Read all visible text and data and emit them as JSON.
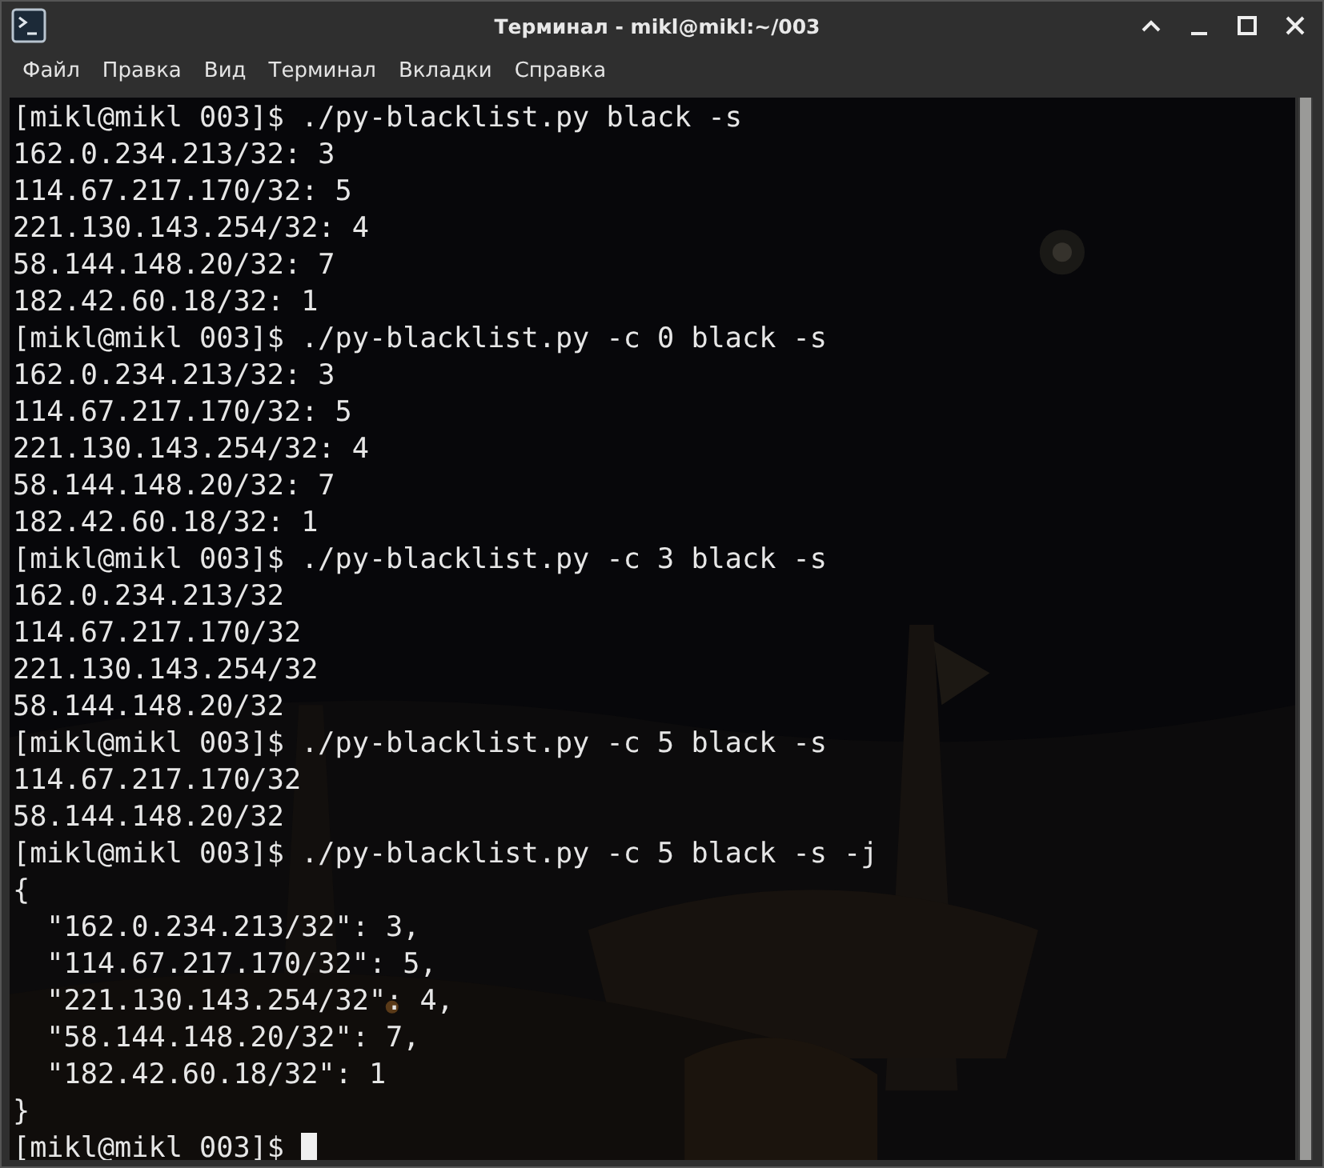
{
  "window": {
    "title": "Терминал - mikl@mikl:~/003"
  },
  "menu": [
    "Файл",
    "Правка",
    "Вид",
    "Терминал",
    "Вкладки",
    "Справка"
  ],
  "terminal": {
    "lines": [
      {
        "text": "[mikl@mikl 003]$ ./py-blacklist.py black -s",
        "cursor": false
      },
      {
        "text": "162.0.234.213/32: 3",
        "cursor": false
      },
      {
        "text": "114.67.217.170/32: 5",
        "cursor": false
      },
      {
        "text": "221.130.143.254/32: 4",
        "cursor": false
      },
      {
        "text": "58.144.148.20/32: 7",
        "cursor": false
      },
      {
        "text": "182.42.60.18/32: 1",
        "cursor": false
      },
      {
        "text": "[mikl@mikl 003]$ ./py-blacklist.py -c 0 black -s",
        "cursor": false
      },
      {
        "text": "162.0.234.213/32: 3",
        "cursor": false
      },
      {
        "text": "114.67.217.170/32: 5",
        "cursor": false
      },
      {
        "text": "221.130.143.254/32: 4",
        "cursor": false
      },
      {
        "text": "58.144.148.20/32: 7",
        "cursor": false
      },
      {
        "text": "182.42.60.18/32: 1",
        "cursor": false
      },
      {
        "text": "[mikl@mikl 003]$ ./py-blacklist.py -c 3 black -s",
        "cursor": false
      },
      {
        "text": "162.0.234.213/32",
        "cursor": false
      },
      {
        "text": "114.67.217.170/32",
        "cursor": false
      },
      {
        "text": "221.130.143.254/32",
        "cursor": false
      },
      {
        "text": "58.144.148.20/32",
        "cursor": false
      },
      {
        "text": "[mikl@mikl 003]$ ./py-blacklist.py -c 5 black -s",
        "cursor": false
      },
      {
        "text": "114.67.217.170/32",
        "cursor": false
      },
      {
        "text": "58.144.148.20/32",
        "cursor": false
      },
      {
        "text": "[mikl@mikl 003]$ ./py-blacklist.py -c 5 black -s -j",
        "cursor": false
      },
      {
        "text": "{",
        "cursor": false
      },
      {
        "text": "  \"162.0.234.213/32\": 3,",
        "cursor": false
      },
      {
        "text": "  \"114.67.217.170/32\": 5,",
        "cursor": false
      },
      {
        "text": "  \"221.130.143.254/32\": 4,",
        "cursor": false
      },
      {
        "text": "  \"58.144.148.20/32\": 7,",
        "cursor": false
      },
      {
        "text": "  \"182.42.60.18/32\": 1",
        "cursor": false
      },
      {
        "text": "}",
        "cursor": false
      },
      {
        "text": "[mikl@mikl 003]$",
        "cursor": true
      }
    ]
  }
}
